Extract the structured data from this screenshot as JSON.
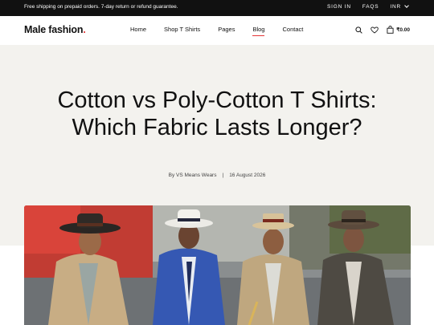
{
  "topbar": {
    "notice": "Free shipping on prepaid orders. 7-day return or refund guarantee.",
    "sign_in": "SIGN IN",
    "faqs": "FAQS",
    "currency": "INR"
  },
  "header": {
    "logo_text": "Male fashion",
    "logo_dot": ".",
    "nav": [
      "Home",
      "Shop T Shirts",
      "Pages",
      "Blog",
      "Contact"
    ],
    "active_nav": "Blog",
    "cart_total": "₹0.00"
  },
  "article": {
    "title": "Cotton vs Poly-Cotton T Shirts: Which Fabric Lasts Longer?",
    "author": "By VS Means Wears",
    "separator": "|",
    "date": "16 August 2026"
  },
  "colors": {
    "accent": "#e53637",
    "topbar_bg": "#111111",
    "hero_bg": "#f3f2ee"
  },
  "icons": [
    "search-icon",
    "heart-icon",
    "bag-icon"
  ]
}
